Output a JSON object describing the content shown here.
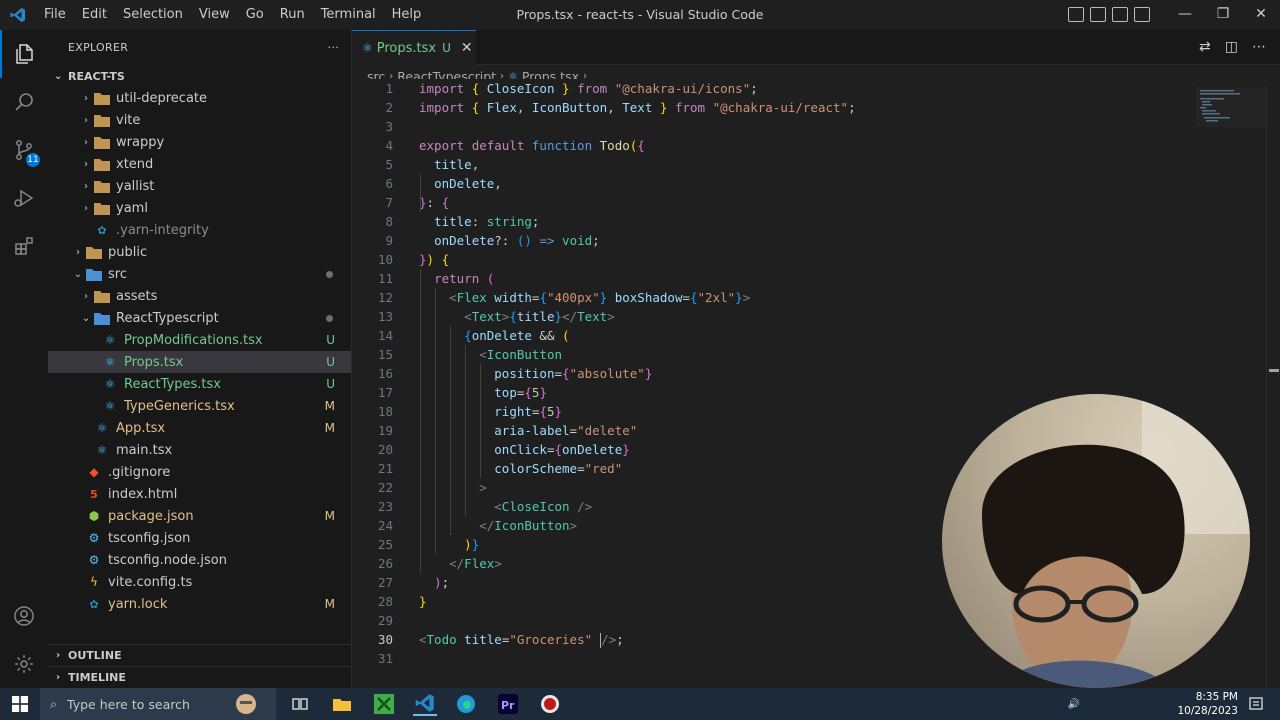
{
  "window": {
    "title": "Props.tsx - react-ts - Visual Studio Code",
    "menu": [
      "File",
      "Edit",
      "Selection",
      "View",
      "Go",
      "Run",
      "Terminal",
      "Help"
    ],
    "controls": [
      "—",
      "❐",
      "✕"
    ]
  },
  "activity": {
    "source_control_badge": "11"
  },
  "explorer": {
    "header": "EXPLORER",
    "more": "···",
    "root": "REACT-TS",
    "items": [
      {
        "label": "util-deprecate",
        "kind": "folder",
        "status": ""
      },
      {
        "label": "vite",
        "kind": "folder",
        "status": ""
      },
      {
        "label": "wrappy",
        "kind": "folder",
        "status": ""
      },
      {
        "label": "xtend",
        "kind": "folder",
        "status": ""
      },
      {
        "label": "yallist",
        "kind": "folder",
        "status": ""
      },
      {
        "label": "yaml",
        "kind": "folder",
        "status": ""
      },
      {
        "label": ".yarn-integrity",
        "kind": "file",
        "status": ""
      },
      {
        "label": "public",
        "kind": "folder",
        "status": ""
      },
      {
        "label": "src",
        "kind": "folder-open",
        "status": ""
      },
      {
        "label": "assets",
        "kind": "folder",
        "status": ""
      },
      {
        "label": "ReactTypescript",
        "kind": "folder-open",
        "status": ""
      },
      {
        "label": "PropModifications.tsx",
        "kind": "tsx",
        "status": "U"
      },
      {
        "label": "Props.tsx",
        "kind": "tsx",
        "status": "U"
      },
      {
        "label": "ReactTypes.tsx",
        "kind": "tsx",
        "status": "U"
      },
      {
        "label": "TypeGenerics.tsx",
        "kind": "tsx",
        "status": "M"
      },
      {
        "label": "App.tsx",
        "kind": "tsx",
        "status": "M"
      },
      {
        "label": "main.tsx",
        "kind": "tsx",
        "status": ""
      },
      {
        "label": ".gitignore",
        "kind": "git",
        "status": ""
      },
      {
        "label": "index.html",
        "kind": "html",
        "status": ""
      },
      {
        "label": "package.json",
        "kind": "json",
        "status": "M"
      },
      {
        "label": "tsconfig.json",
        "kind": "tsconfig",
        "status": ""
      },
      {
        "label": "tsconfig.node.json",
        "kind": "tsconfig",
        "status": ""
      },
      {
        "label": "vite.config.ts",
        "kind": "vite",
        "status": ""
      },
      {
        "label": "yarn.lock",
        "kind": "yarn",
        "status": "M"
      }
    ],
    "outline": "OUTLINE",
    "timeline": "TIMELINE"
  },
  "editor": {
    "tab": {
      "label": "Props.tsx",
      "status": "U",
      "close": "✕"
    },
    "breadcrumb": [
      "src",
      "ReactTypescript",
      "Props.tsx",
      "..."
    ],
    "current_line": 30
  },
  "taskbar": {
    "search_placeholder": "Type here to search",
    "time": "8:35 PM",
    "date": "10/28/2023"
  },
  "colors": {
    "accent": "#0078d4",
    "untracked": "#73c991",
    "modified": "#e2c08d",
    "editor_bg": "#1f1f1f"
  }
}
